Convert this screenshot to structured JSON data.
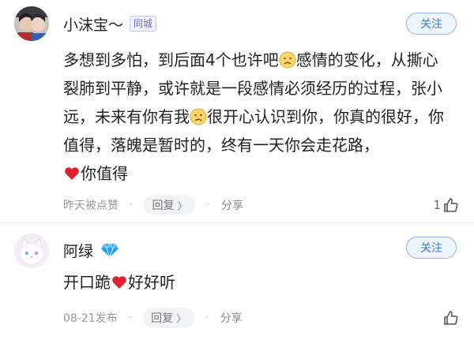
{
  "comments": [
    {
      "author": "小沫宝〜",
      "badge": "同城",
      "follow_label": "关注",
      "text_parts": {
        "p1": "多想到多怕，到后面4个也许吧",
        "p2": "感情的变化，从撕心裂肺到平静，或许就是一段感情必须经历的过程，张小远，未来有你有我",
        "p3": "很开心认识到你，你真的很好，你值得，落魄是暂时的，终有一天你会走花路，",
        "p4": "你值得"
      },
      "time": "昨天被点赞",
      "reply_label": "回复",
      "share_label": "分享",
      "like_count": "1"
    },
    {
      "author": "阿绿",
      "badge_icon": "diamond-vip-icon",
      "follow_label": "关注",
      "text_parts": {
        "p1": "开口跪",
        "p2": "好好听"
      },
      "time": "08-21发布",
      "reply_label": "回复",
      "share_label": "分享",
      "like_count": ""
    }
  ],
  "icons": {
    "emoji_sad": "sad-face-emoji-icon",
    "emoji_heart": "red-heart-emoji-icon",
    "like": "thumb-up-icon",
    "reply_chevron": "chevron-right-icon"
  },
  "colors": {
    "follow_text": "#3d7ad6",
    "follow_border": "#8fb3e8",
    "badge_text": "#6b6fc8",
    "meta_text": "#999999",
    "heart": "#e0202f",
    "vip_diamond": "#3fb5ff"
  }
}
